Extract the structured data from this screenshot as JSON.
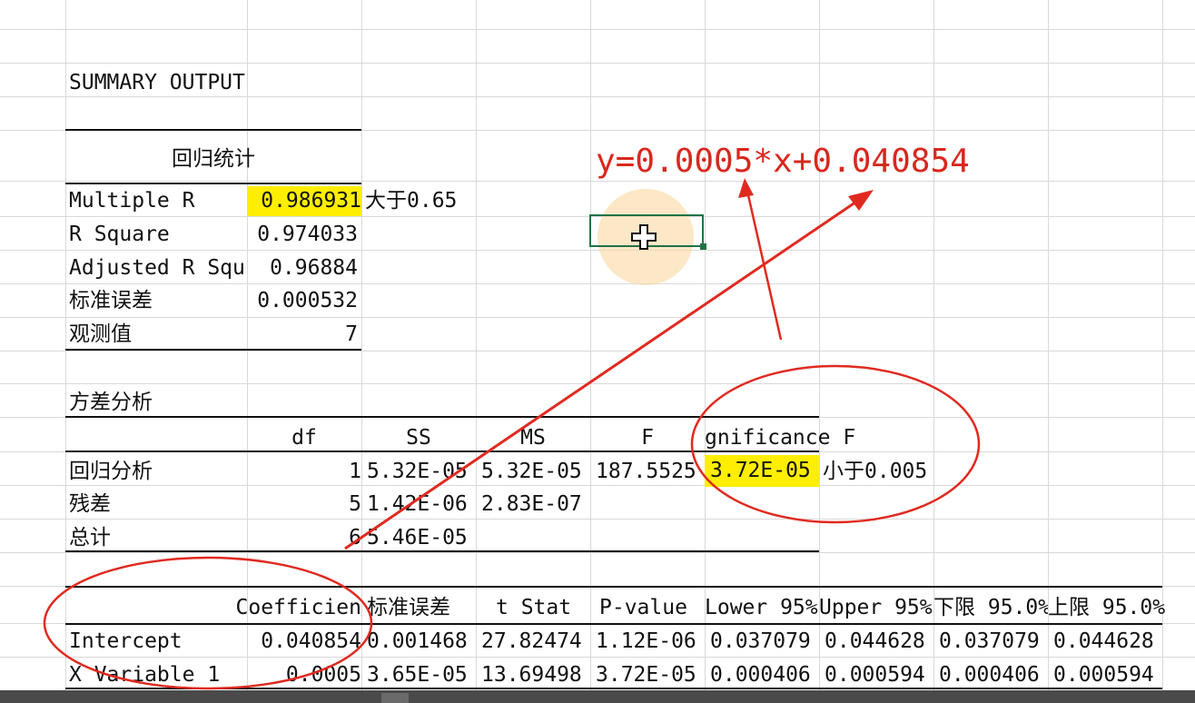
{
  "summary_title": "SUMMARY OUTPUT",
  "regression_stats": {
    "header": "回归统计",
    "rows": [
      {
        "label": "Multiple R",
        "value": "0.986931",
        "note": "大于0.65"
      },
      {
        "label": "R Square",
        "value": "0.974033"
      },
      {
        "label": "Adjusted R Squ",
        "value": "0.96884"
      },
      {
        "label": "标准误差",
        "value": "0.000532"
      },
      {
        "label": "观测值",
        "value": "7"
      }
    ]
  },
  "anova": {
    "title": "方差分析",
    "headers": [
      "df",
      "SS",
      "MS",
      "F",
      "gnificance F"
    ],
    "rows": [
      {
        "label": "回归分析",
        "df": "1",
        "ss": "5.32E-05",
        "ms": "5.32E-05",
        "f": "187.5525",
        "sig": "3.72E-05",
        "note": "小于0.005"
      },
      {
        "label": "残差",
        "df": "5",
        "ss": "1.42E-06",
        "ms": "2.83E-07"
      },
      {
        "label": "总计",
        "df": "6",
        "ss": "5.46E-05"
      }
    ]
  },
  "coefficients": {
    "headers": [
      "Coefficien",
      "标准误差",
      "t Stat",
      "P-value",
      "Lower 95%",
      "Upper 95%",
      "下限 95.0%",
      "上限 95.0%"
    ],
    "rows": [
      {
        "label": "Intercept",
        "values": [
          "0.040854",
          "0.001468",
          "27.82474",
          "1.12E-06",
          "0.037079",
          "0.044628",
          "0.037079",
          "0.044628"
        ]
      },
      {
        "label": "X Variable 1",
        "values": [
          "0.0005",
          "3.65E-05",
          "13.69498",
          "3.72E-05",
          "0.000406",
          "0.000594",
          "0.000406",
          "0.000594"
        ]
      }
    ]
  },
  "annotation_formula": "y=0.0005*x+0.040854",
  "colors": {
    "highlight": "#ffee00",
    "annotation": "#d8281e",
    "selection": "#217346"
  },
  "icons": {
    "cursor": "plus-cross-cursor-icon"
  }
}
